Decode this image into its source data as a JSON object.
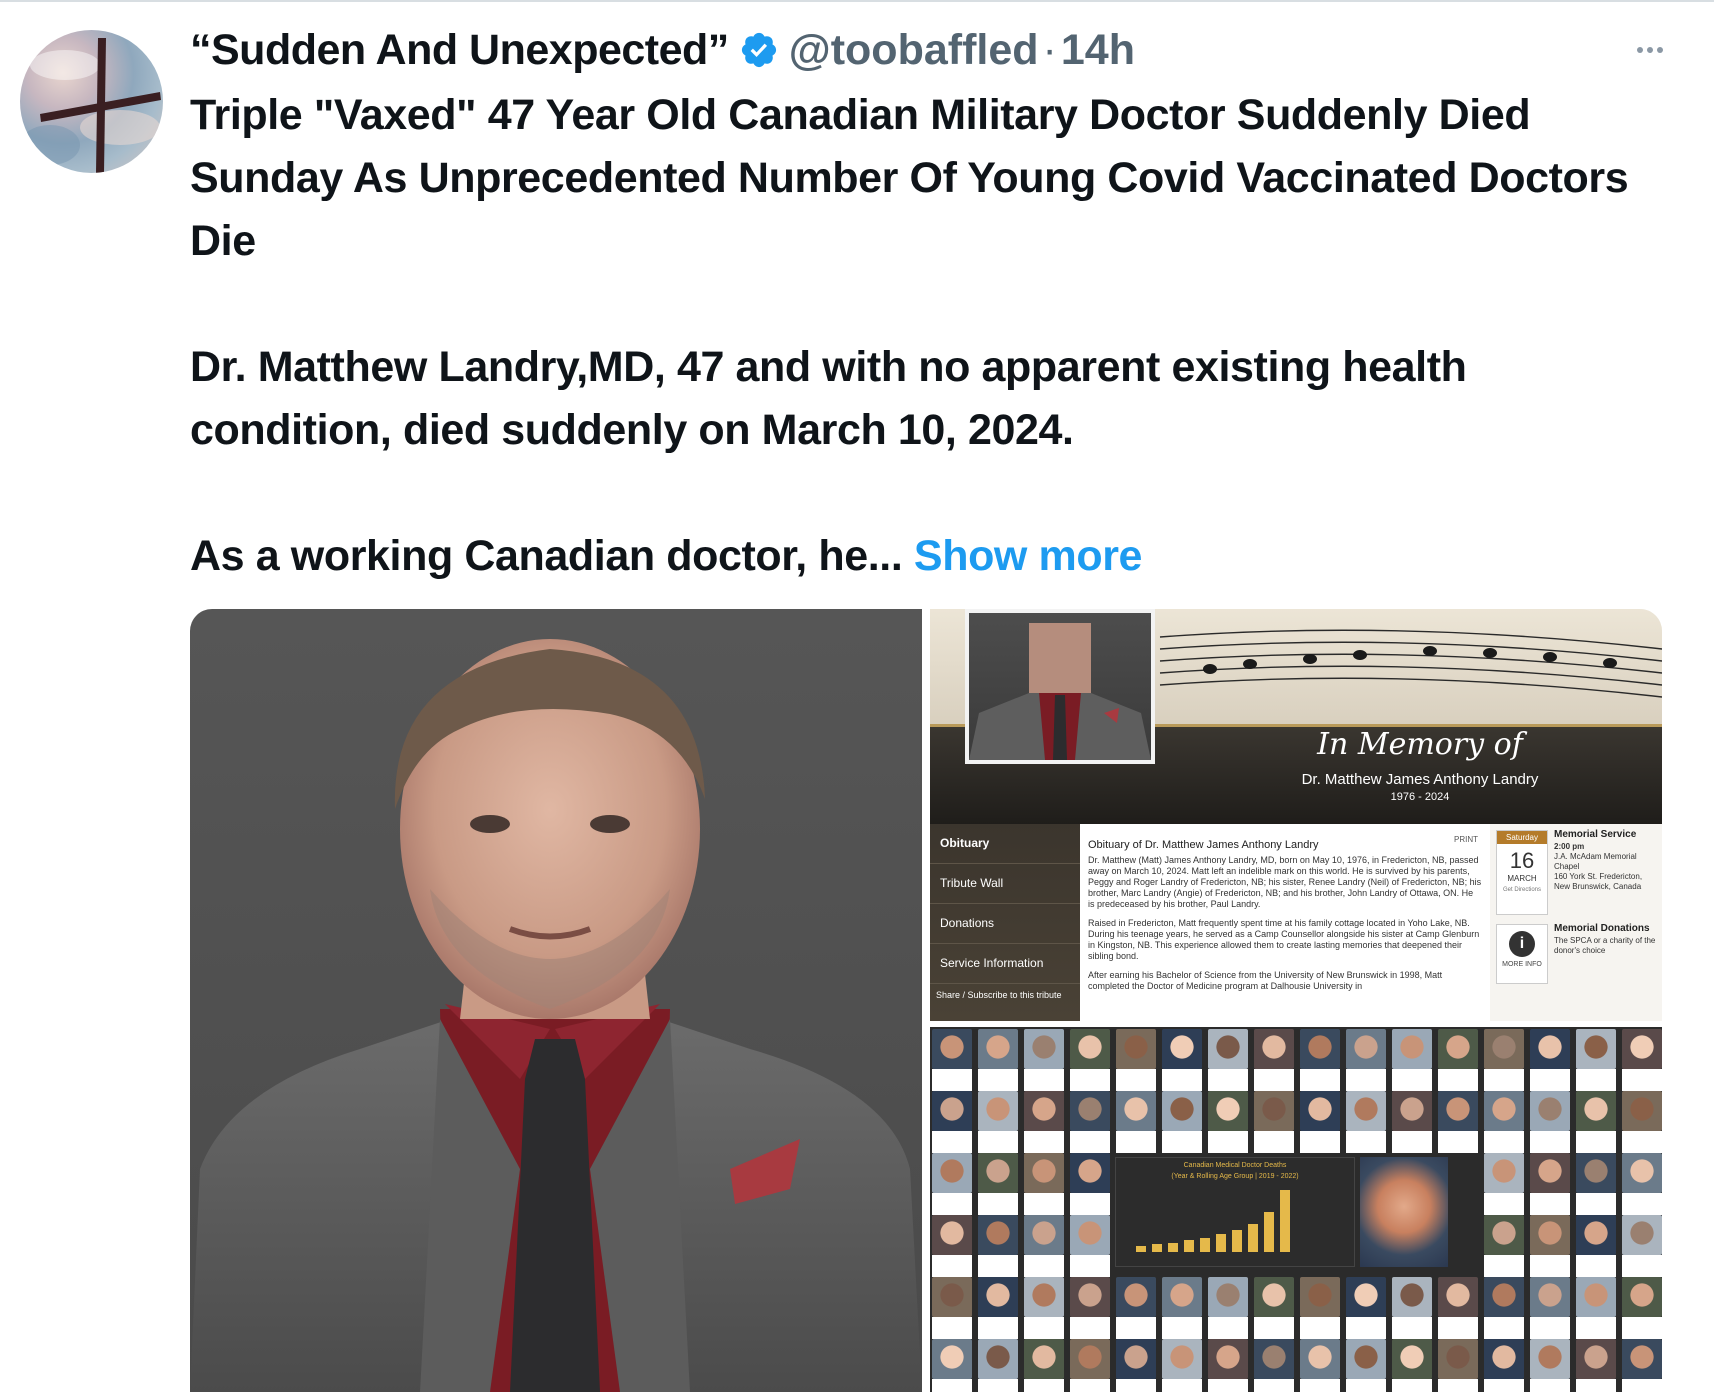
{
  "author": {
    "display_name": "“Sudden And Unexpected”",
    "handle": "@toobaffled",
    "separator": "·",
    "time": "14h",
    "verified": true,
    "avatar_icon": "cross-on-sky-avatar"
  },
  "tweet": {
    "paragraphs": [
      "Triple \"Vaxed\" 47 Year Old Canadian Military Doctor Suddenly Died Sunday As Unprecedented Number Of Young Covid Vaccinated Doctors Die",
      "Dr. Matthew Landry,MD, 47 and with no apparent existing health condition, died suddenly on March 10, 2024.",
      "As a working Canadian doctor, he..."
    ],
    "show_more_label": "Show more"
  },
  "icons": {
    "verified": "verified-badge-icon",
    "more": "more-options-icon"
  },
  "colors": {
    "text": "#0f1419",
    "secondary": "#536471",
    "link": "#1d9bf0",
    "verified": "#1d9bf0"
  },
  "media": {
    "memorial": {
      "in_memory": "In Memory of",
      "name": "Dr. Matthew James Anthony Landry",
      "years": "1976 - 2024",
      "nav": [
        "Obituary",
        "Tribute Wall",
        "Donations",
        "Service Information"
      ],
      "share": "Share / Subscribe to this tribute",
      "print": "PRINT",
      "obituary_heading": "Obituary of Dr. Matthew James Anthony Landry",
      "obituary_p1": "Dr. Matthew (Matt) James Anthony Landry, MD, born on May 10, 1976, in Fredericton, NB, passed away on March 10, 2024. Matt left an indelible mark on this world. He is survived by his parents, Peggy and Roger Landry of Fredericton, NB; his sister, Renee Landry (Neil) of Fredericton, NB; his brother, Marc Landry (Angie) of Fredericton, NB; and his brother, John Landry of Ottawa, ON. He is predeceased by his brother, Paul Landry.",
      "obituary_p2": "Raised in Fredericton, Matt frequently spent time at his family cottage located in Yoho Lake, NB. During his teenage years, he served as a Camp Counsellor alongside his sister at Camp Glenburn in Kingston, NB. This experience allowed them to create lasting memories that deepened their sibling bond.",
      "obituary_p3": "After earning his Bachelor of Science from the University of New Brunswick in 1998, Matt completed the Doctor of Medicine program at Dalhousie University in",
      "service_day": "Saturday",
      "service_date": "16",
      "service_month": "MARCH",
      "get_directions": "Get Directions",
      "service_title": "Memorial Service",
      "service_time": "2:00 pm",
      "service_place": "J.A. McAdam Memorial Chapel",
      "service_address": "160 York St. Fredericton, New Brunswick, Canada",
      "more_info": "MORE INFO",
      "donations_title": "Memorial Donations",
      "donations_text": "The SPCA or a charity of the donor's choice"
    },
    "collage": {
      "chart_title": "Canadian Medical Doctor Deaths",
      "chart_subtitle": "(Year & Rolling Age Group | 2019 - 2022)"
    }
  }
}
